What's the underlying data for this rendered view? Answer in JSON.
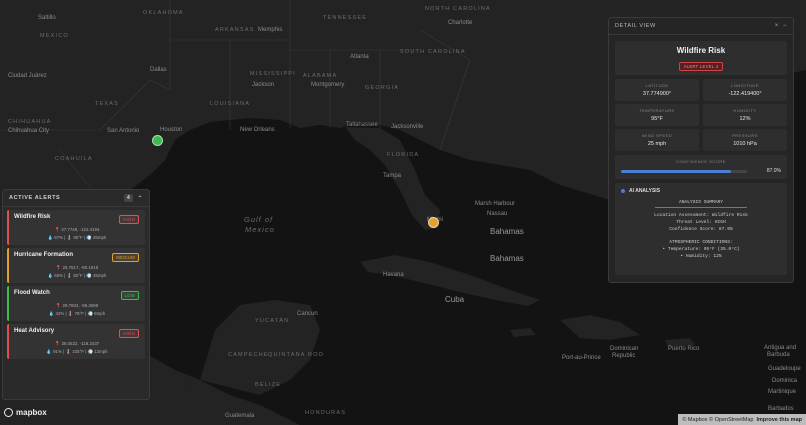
{
  "map": {
    "land_color": "#1f1f1f",
    "water_color": "#111111",
    "labels": {
      "mexico_top": "MEXICO",
      "saltillo": "Saltillo",
      "oklahoma": "OKLAHOMA",
      "arkansas": "ARKANSAS",
      "memphis": "Memphis",
      "tennessee": "TENNESSEE",
      "north_carolina": "NORTH CAROLINA",
      "charlotte": "Charlotte",
      "south_carolina": "SOUTH CAROLINA",
      "atlanta": "Atlanta",
      "dallas": "Dallas",
      "mississippi": "MISSISSIPPI",
      "alabama": "ALABAMA",
      "georgia": "GEORGIA",
      "jackson": "Jackson",
      "montgomery": "Montgomery",
      "ciudad_juarez": "Ciudad Juárez",
      "texas": "TEXAS",
      "louisiana": "LOUISIANA",
      "chihuahua": "CHIHUAHUA",
      "chihuahua_city": "Chihuahua City",
      "san_antonio": "San Antonio",
      "houston": "Houston",
      "new_orleans": "New Orleans",
      "tallahassee": "Tallahassee",
      "jacksonville": "Jacksonville",
      "coahuila": "COAHUILA",
      "florida": "FLORIDA",
      "tampa": "Tampa",
      "marsh_harbour": "Marsh Harbour",
      "nassau": "Nassau",
      "miami": "Miami",
      "gulf_of_mexico_1": "Gulf of",
      "gulf_of_mexico_2": "Mexico",
      "bahamas": "Bahamas",
      "bahamas2": "Bahamas",
      "havana": "Havana",
      "cuba": "Cuba",
      "cancun": "Cancun",
      "yucatan": "YUCATÁN",
      "campeche": "CAMPECHE",
      "quintana_roo": "QUINTANA ROO",
      "port_au_prince": "Port-au-Prince",
      "dominican_republic_1": "Dominican",
      "dominican_republic_2": "Republic",
      "puerto_rico": "Puerto Rico",
      "antigua_1": "Antigua and",
      "antigua_2": "Barbuda",
      "guadeloupe": "Guadeloupe",
      "dominica": "Dominica",
      "martinique": "Martinique",
      "barbados": "Barbados",
      "guatemala": "Guatemala",
      "belize": "BELIZE",
      "honduras": "HONDURAS"
    },
    "markers": [
      {
        "name": "Houston marker",
        "color": "#3fb950"
      },
      {
        "name": "Miami marker",
        "color": "#e3a035"
      }
    ]
  },
  "alerts_panel": {
    "title": "ACTIVE ALERTS",
    "count": "4",
    "collapse_icon": "chevron-up-icon",
    "items": [
      {
        "title": "Wildfire Risk",
        "level": "HIGH",
        "color": "#d9534f",
        "location": "📍 37.7749, -122.4194",
        "stats": "💧 87% | 🌡️ 95°F | 💨 25mph"
      },
      {
        "title": "Hurricane Formation",
        "level": "MEDIUM",
        "color": "#e0a030",
        "location": "📍 25.7617, -80.1918",
        "stats": "💧 65% | 🌡️ 82°F | 💨 45mph"
      },
      {
        "title": "Flood Watch",
        "level": "LOW",
        "color": "#3fb950",
        "location": "📍 29.7604, -95.3698",
        "stats": "💧 42% | 🌡️ 78°F | 💨 8mph"
      },
      {
        "title": "Heat Advisory",
        "level": "HIGH",
        "color": "#d9534f",
        "location": "📍 36.0522, -118.2437",
        "stats": "💧 91% | 🌡️ 105°F | 💨 12mph"
      }
    ]
  },
  "detail_panel": {
    "header": "DETAIL VIEW",
    "close_icon": "×",
    "collapse_icon": "−",
    "title": "Wildfire Risk",
    "alert_level": "ALERT LEVEL 4",
    "metrics": [
      {
        "label": "LATITUDE",
        "value": "37.774900°"
      },
      {
        "label": "LONGITUDE",
        "value": "-122.419400°"
      },
      {
        "label": "TEMPERATURE",
        "value": "95°F"
      },
      {
        "label": "HUMIDITY",
        "value": "12%"
      },
      {
        "label": "WIND SPEED",
        "value": "25 mph"
      },
      {
        "label": "PRESSURE",
        "value": "1010 hPa"
      }
    ],
    "confidence": {
      "label": "CONFIDENCE SCORE",
      "value": 0.87,
      "text": "87.0%"
    },
    "ai": {
      "title": "AI ANALYSIS",
      "summary_title": "ANALYSIS SUMMARY",
      "lines": [
        "Location Assessment: Wildfire Risk",
        "Threat Level: HIGH",
        "Confidence Score: 87.0%"
      ],
      "conditions_title": "ATMOSPHERIC CONDITIONS:",
      "conditions": [
        "• Temperature: 95°F (35.0°C)",
        "• Humidity: 12%"
      ]
    }
  },
  "footer": {
    "logo": "mapbox",
    "attr_mapbox": "© Mapbox",
    "attr_osm": "© OpenStreetMap",
    "improve": "Improve this map"
  }
}
